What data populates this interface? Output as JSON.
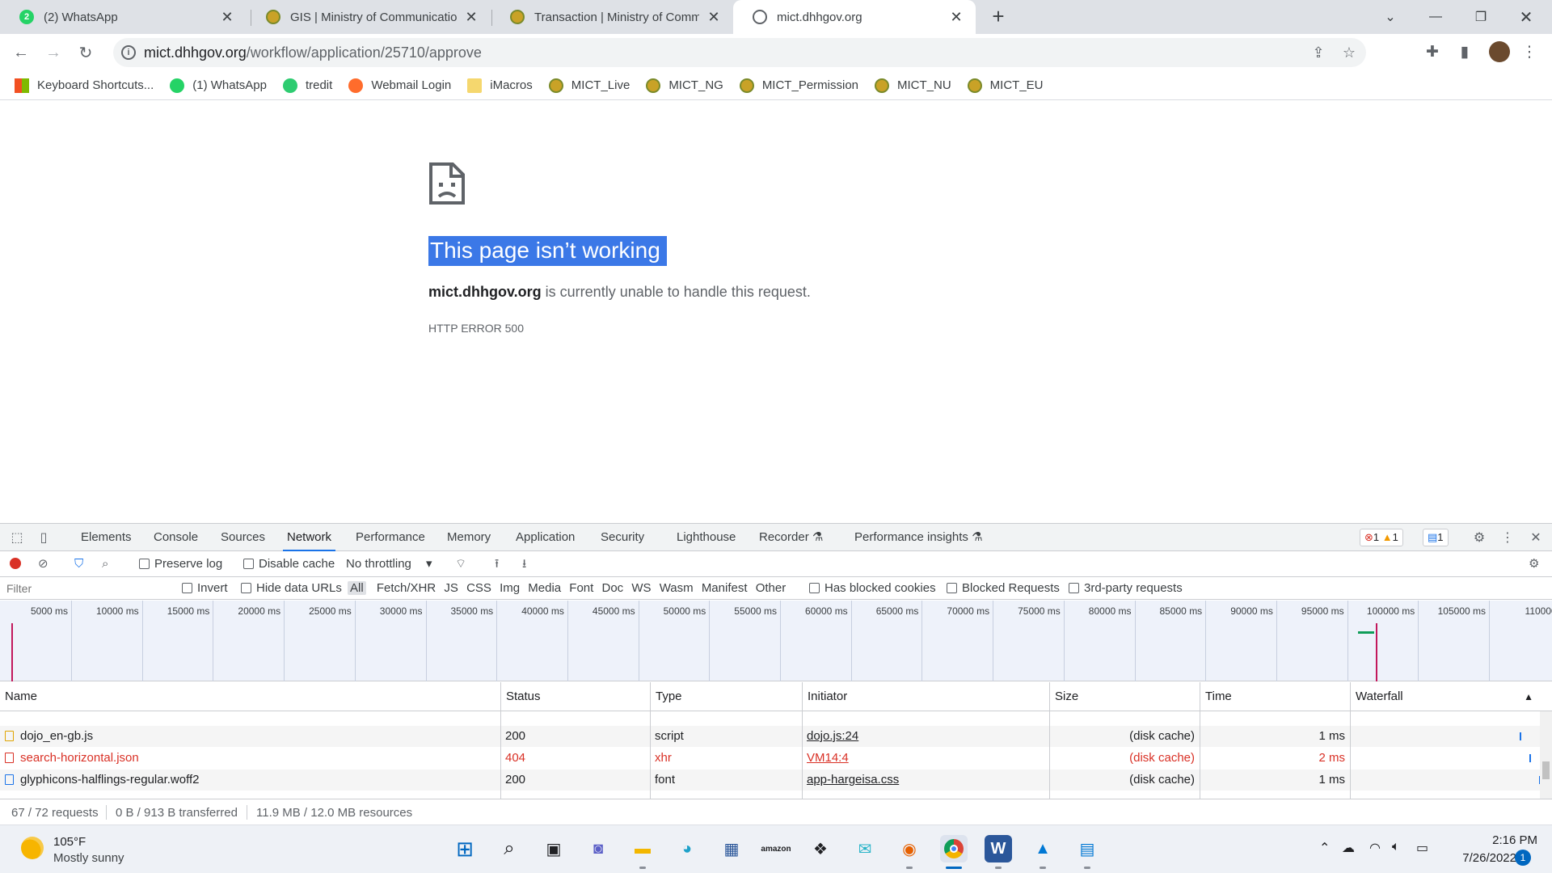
{
  "tabs": [
    {
      "title": "(2) WhatsApp",
      "icon": "whatsapp-icon",
      "badge": "2"
    },
    {
      "title": "GIS | Ministry of Communication",
      "icon": "ministry-seal-icon"
    },
    {
      "title": "Transaction | Ministry of Commun",
      "icon": "ministry-seal-icon"
    },
    {
      "title": "mict.dhhgov.org",
      "icon": "globe-icon",
      "active": true
    }
  ],
  "address": {
    "host": "mict.dhhgov.org",
    "path": "/workflow/application/25710/approve"
  },
  "bookmarks": [
    {
      "label": "Keyboard Shortcuts...",
      "icon": "microsoft-icon"
    },
    {
      "label": "(1) WhatsApp",
      "icon": "whatsapp-icon"
    },
    {
      "label": "tredit",
      "icon": "tredit-icon"
    },
    {
      "label": "Webmail Login",
      "icon": "cpanel-icon"
    },
    {
      "label": "iMacros",
      "icon": "folder-icon"
    },
    {
      "label": "MICT_Live",
      "icon": "ministry-seal-icon"
    },
    {
      "label": "MICT_NG",
      "icon": "ministry-seal-icon"
    },
    {
      "label": "MICT_Permission",
      "icon": "ministry-seal-icon"
    },
    {
      "label": "MICT_NU",
      "icon": "ministry-seal-icon"
    },
    {
      "label": "MICT_EU",
      "icon": "ministry-seal-icon"
    }
  ],
  "error": {
    "title": "This page isn’t working",
    "host": "mict.dhhgov.org",
    "message": " is currently unable to handle this request.",
    "code": "HTTP ERROR 500"
  },
  "devtools": {
    "tabs": [
      "Elements",
      "Console",
      "Sources",
      "Network",
      "Performance",
      "Memory",
      "Application",
      "Security",
      "Lighthouse",
      "Recorder",
      "Performance insights"
    ],
    "active_tab": "Network",
    "counts": {
      "errors": "1",
      "warnings": "1",
      "messages": "1"
    },
    "toolbar": {
      "preserve_log": "Preserve log",
      "disable_cache": "Disable cache",
      "throttling": "No throttling"
    },
    "filter": {
      "placeholder": "Filter",
      "invert": "Invert",
      "hide_data_urls": "Hide data URLs",
      "types": [
        "All",
        "Fetch/XHR",
        "JS",
        "CSS",
        "Img",
        "Media",
        "Font",
        "Doc",
        "WS",
        "Wasm",
        "Manifest",
        "Other"
      ],
      "has_blocked_cookies": "Has blocked cookies",
      "blocked_requests": "Blocked Requests",
      "third_party": "3rd-party requests"
    },
    "timeline_ticks": [
      "5000 ms",
      "10000 ms",
      "15000 ms",
      "20000 ms",
      "25000 ms",
      "30000 ms",
      "35000 ms",
      "40000 ms",
      "45000 ms",
      "50000 ms",
      "55000 ms",
      "60000 ms",
      "65000 ms",
      "70000 ms",
      "75000 ms",
      "80000 ms",
      "85000 ms",
      "90000 ms",
      "95000 ms",
      "100000 ms",
      "105000 ms",
      "110000"
    ],
    "columns": [
      "Name",
      "Status",
      "Type",
      "Initiator",
      "Size",
      "Time",
      "Waterfall"
    ],
    "rows": [
      {
        "name": "dojo_en-gb.js",
        "status": "200",
        "type": "script",
        "initiator": "dojo.js:24",
        "size": "(disk cache)",
        "time": "1 ms",
        "error": false
      },
      {
        "name": "search-horizontal.json",
        "status": "404",
        "type": "xhr",
        "initiator": "VM14:4",
        "size": "(disk cache)",
        "time": "2 ms",
        "error": true
      },
      {
        "name": "glyphicons-halflings-regular.woff2",
        "status": "200",
        "type": "font",
        "initiator": "app-hargeisa.css",
        "size": "(disk cache)",
        "time": "1 ms",
        "error": false
      }
    ],
    "status_bar": {
      "requests": "67 / 72 requests",
      "transferred": "0 B / 913 B transferred",
      "resources": "11.9 MB / 12.0 MB resources"
    }
  },
  "taskbar": {
    "weather_temp": "105°F",
    "weather_desc": "Mostly sunny",
    "time": "2:16 PM",
    "date": "7/26/2022",
    "notifications": "1"
  },
  "colors": {
    "accent": "#1a73e8",
    "selection": "#3b78e7",
    "error_red": "#d93025"
  }
}
